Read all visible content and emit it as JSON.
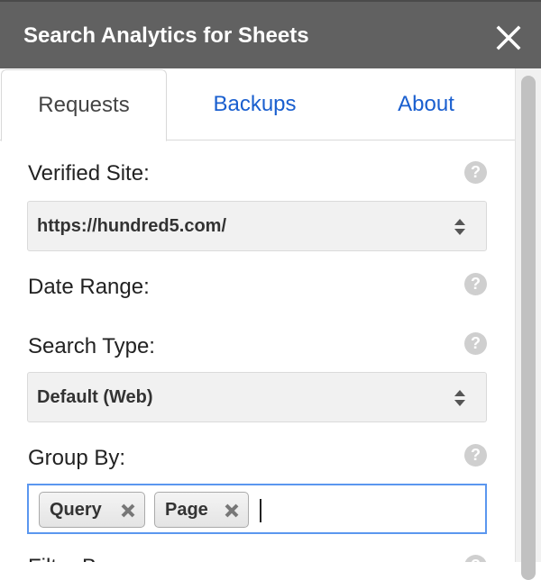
{
  "window": {
    "title": "Search Analytics for Sheets",
    "close_icon": "close-icon"
  },
  "tabs": [
    {
      "label": "Requests",
      "active": true
    },
    {
      "label": "Backups",
      "active": false
    },
    {
      "label": "About",
      "active": false
    }
  ],
  "form": {
    "verified_site": {
      "label": "Verified Site:",
      "value": "https://hundred5.com/",
      "help": "?"
    },
    "date_range": {
      "label": "Date Range:",
      "help": "?"
    },
    "search_type": {
      "label": "Search Type:",
      "value": "Default (Web)",
      "help": "?"
    },
    "group_by": {
      "label": "Group By:",
      "help": "?",
      "tags": [
        {
          "label": "Query"
        },
        {
          "label": "Page"
        }
      ]
    },
    "filter_by": {
      "label": "Filter By:",
      "help": "?"
    }
  },
  "colors": {
    "titlebar": "#616161",
    "tab_link": "#1a5fcf",
    "focus_border": "#5b97ef",
    "help_icon": "#cfcfcf"
  }
}
